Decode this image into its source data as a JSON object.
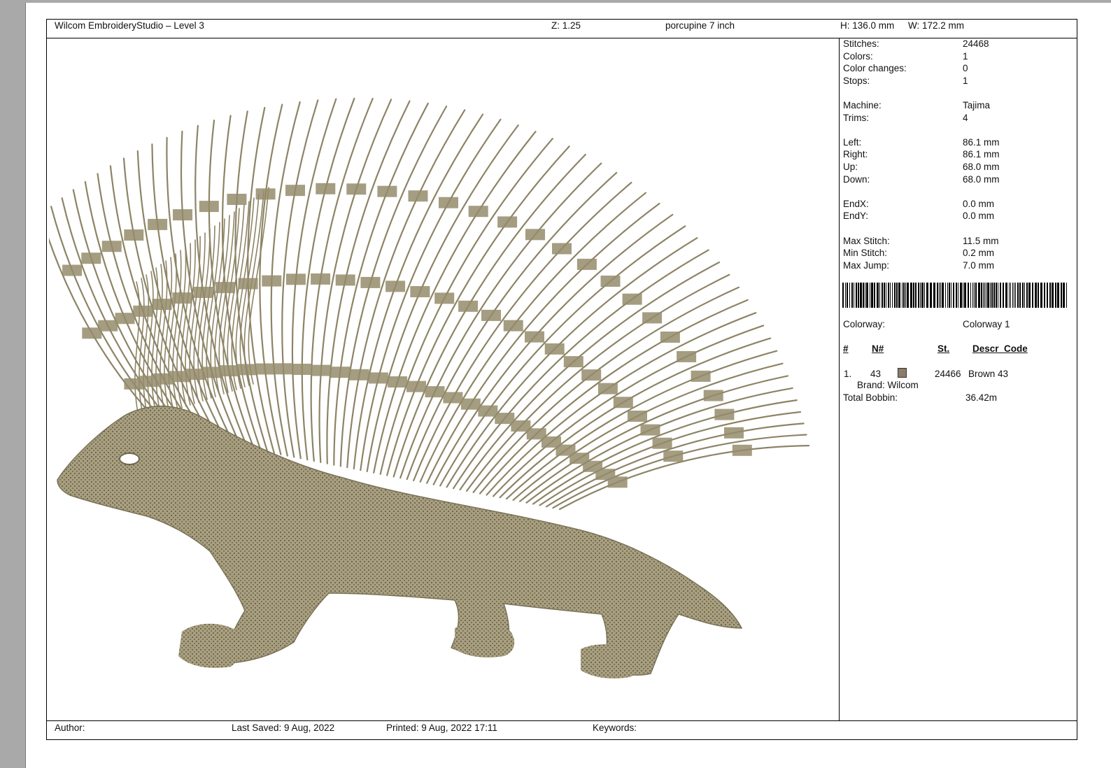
{
  "header": {
    "app_title": "Wilcom EmbroideryStudio – Level 3",
    "zoom": "Z: 1.25",
    "design_name": "porcupine 7 inch",
    "height": "H: 136.0 mm",
    "width": "W: 172.2 mm"
  },
  "stats": [
    {
      "label": "Stitches:",
      "value": "24468"
    },
    {
      "label": "Colors:",
      "value": "1"
    },
    {
      "label": "Color changes:",
      "value": "0"
    },
    {
      "label": "Stops:",
      "value": "1"
    },
    {
      "label": "Machine:",
      "value": "Tajima"
    },
    {
      "label": "Trims:",
      "value": "4"
    },
    {
      "label": "Left:",
      "value": "86.1 mm"
    },
    {
      "label": "Right:",
      "value": "86.1 mm"
    },
    {
      "label": "Up:",
      "value": "68.0 mm"
    },
    {
      "label": "Down:",
      "value": "68.0 mm"
    },
    {
      "label": "EndX:",
      "value": "0.0 mm"
    },
    {
      "label": "EndY:",
      "value": "0.0 mm"
    },
    {
      "label": "Max Stitch:",
      "value": "11.5 mm"
    },
    {
      "label": "Min Stitch:",
      "value": "0.2 mm"
    },
    {
      "label": "Max Jump:",
      "value": "7.0 mm"
    }
  ],
  "colorway": {
    "label": "Colorway:",
    "value": "Colorway 1"
  },
  "color_table": {
    "headers": [
      "#",
      "N#",
      "St.",
      "Descr_Code"
    ],
    "rows": [
      {
        "index": "1.",
        "n": "43",
        "swatch": "#8b7d68",
        "stitches": "24466",
        "descr": "Brown 43",
        "brand": "Brand: Wilcom"
      }
    ]
  },
  "bobbin": {
    "label": "Total Bobbin:",
    "value": "36.42m"
  },
  "footer": {
    "author": "Author:",
    "last_saved": "Last Saved:  9 Aug, 2022",
    "printed": "Printed:  9 Aug, 2022 17:11",
    "keywords": "Keywords:"
  },
  "colors": {
    "thread": "#a39a79",
    "thread_dark": "#6e6650",
    "background": "#a9a9a9"
  }
}
